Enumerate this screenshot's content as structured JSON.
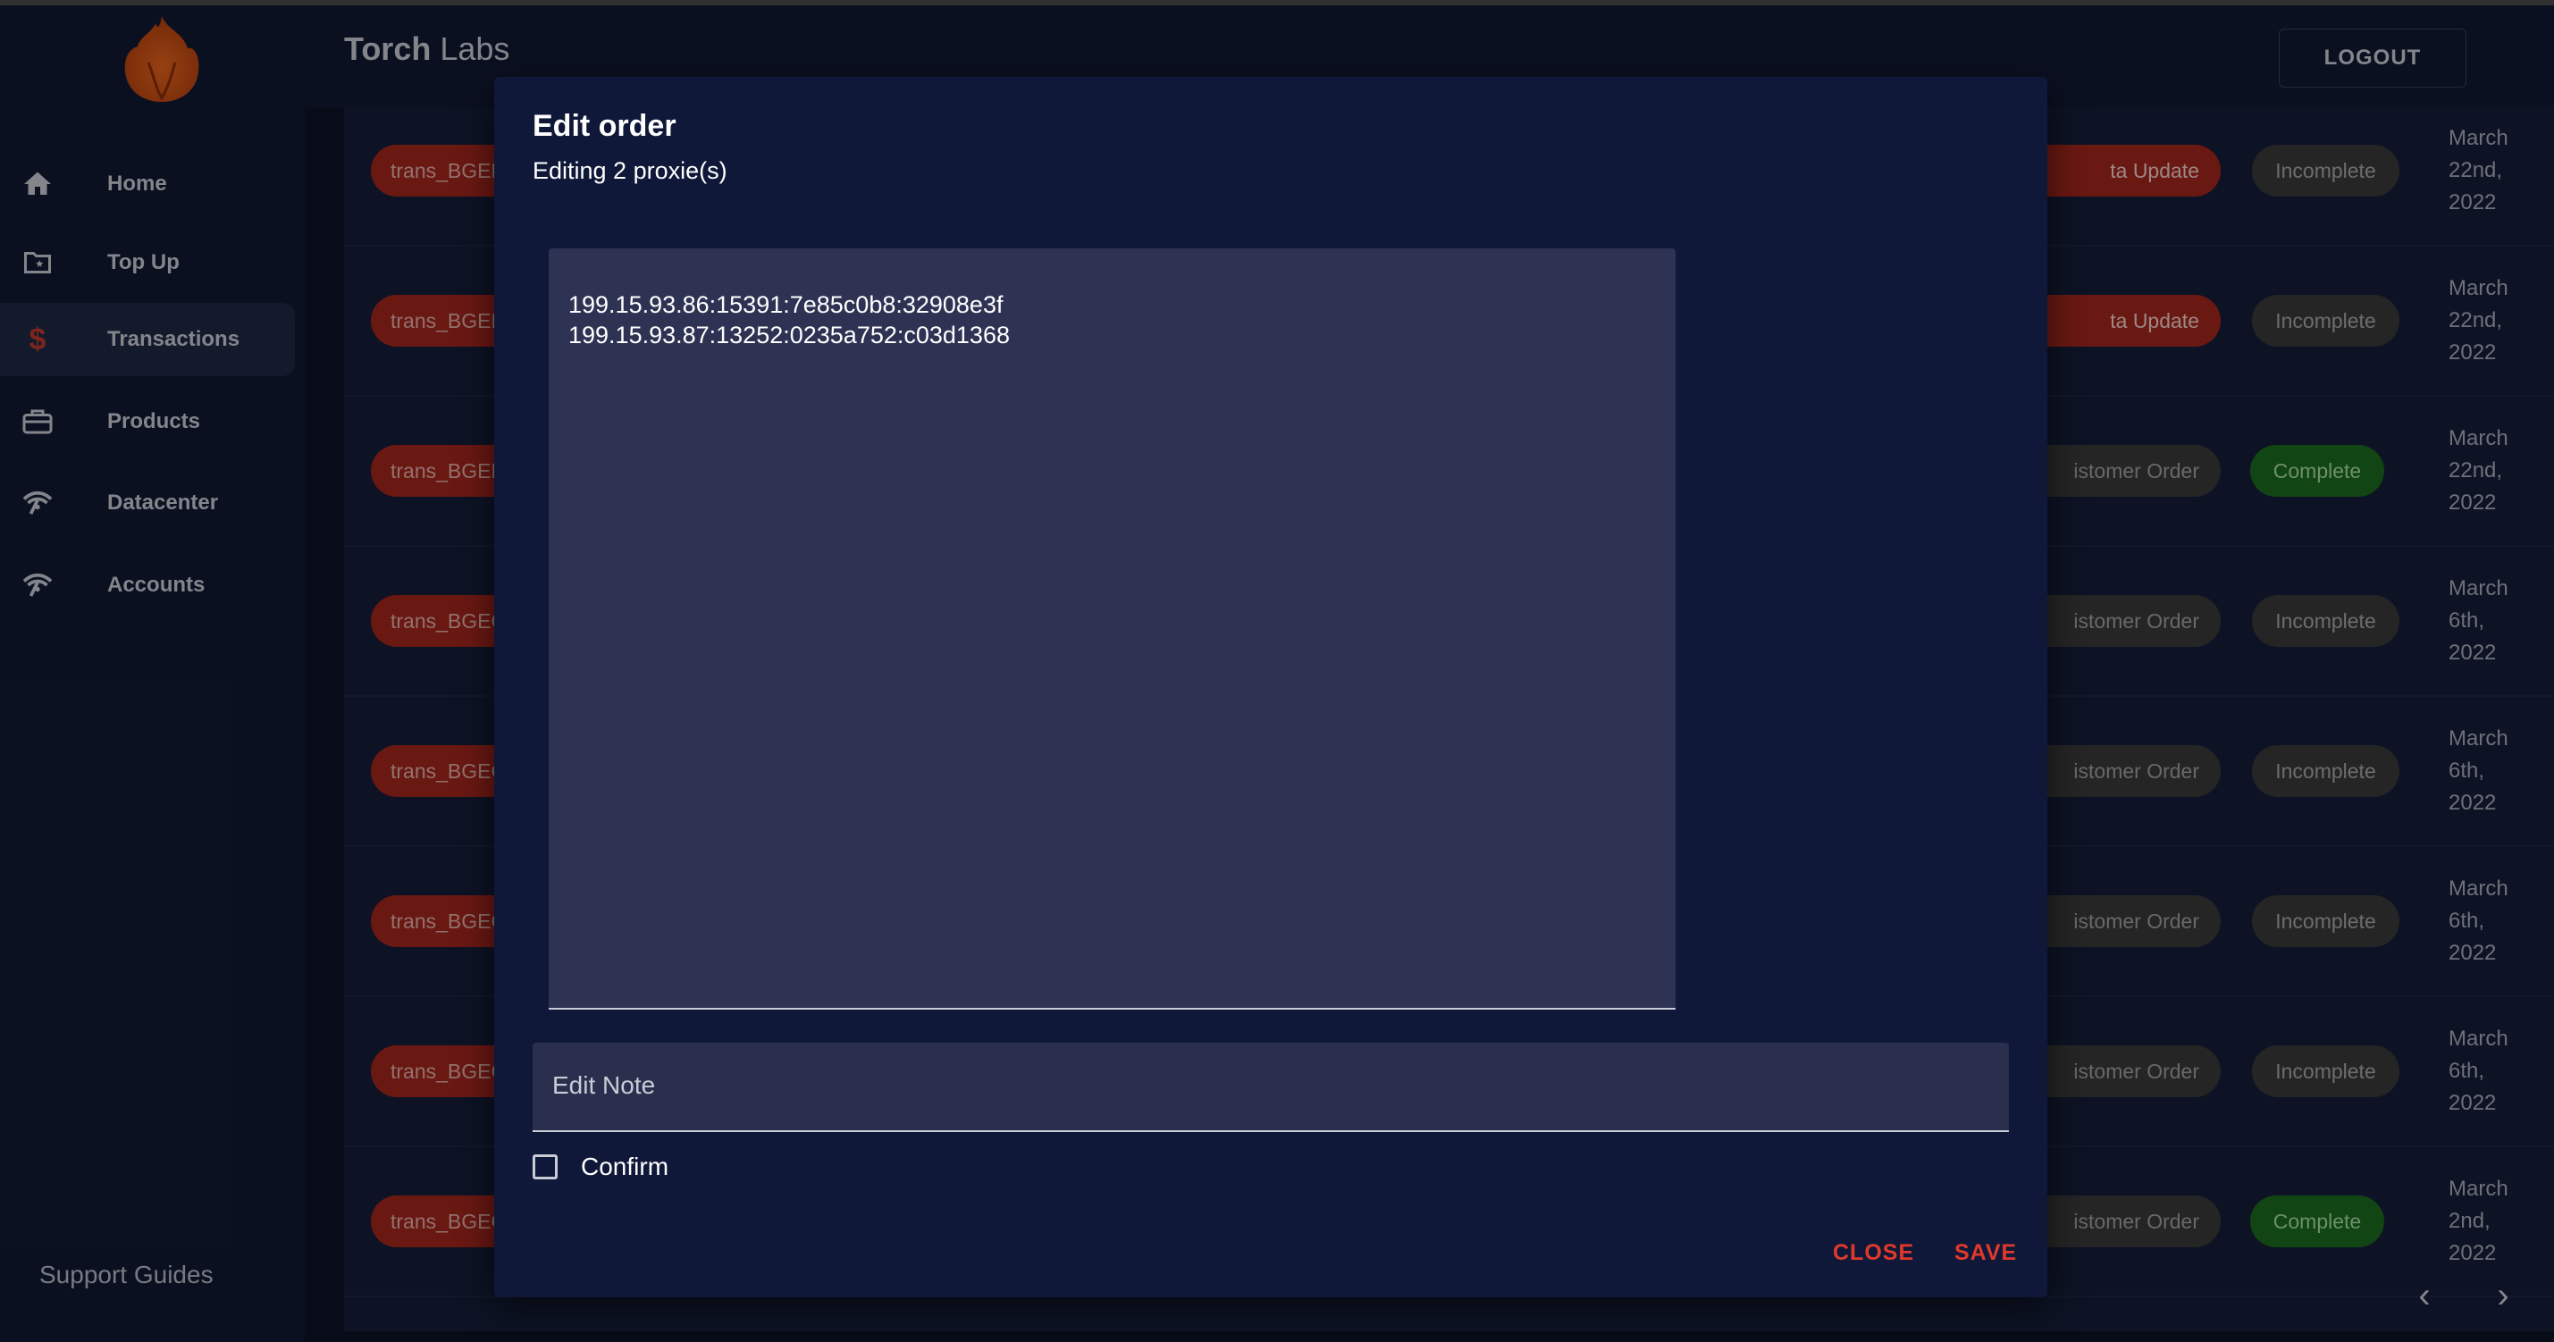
{
  "header": {
    "brand_bold": "Torch",
    "brand_light": "Labs",
    "logout_label": "LOGOUT"
  },
  "sidebar": {
    "items": [
      {
        "label": "Home",
        "icon": "home-icon"
      },
      {
        "label": "Top Up",
        "icon": "folder-star-icon"
      },
      {
        "label": "Transactions",
        "icon": "dollar-icon",
        "active": true
      },
      {
        "label": "Products",
        "icon": "briefcase-icon"
      },
      {
        "label": "Datacenter",
        "icon": "wifi-icon"
      },
      {
        "label": "Accounts",
        "icon": "wifi-icon"
      }
    ],
    "support_label": "Support Guides"
  },
  "table": {
    "rows": [
      {
        "id": "trans_BGEH",
        "type": "ta Update",
        "status": "Incomplete",
        "date_l1": "March",
        "date_l2": "22nd,",
        "date_l3": "2022"
      },
      {
        "id": "trans_BGEH",
        "type": "ta Update",
        "status": "Incomplete",
        "date_l1": "March",
        "date_l2": "22nd,",
        "date_l3": "2022"
      },
      {
        "id": "trans_BGEH",
        "type": "istomer Order",
        "status": "Complete",
        "date_l1": "March",
        "date_l2": "22nd,",
        "date_l3": "2022"
      },
      {
        "id": "trans_BGEC",
        "type": "istomer Order",
        "status": "Incomplete",
        "date_l1": "March",
        "date_l2": "6th,",
        "date_l3": "2022"
      },
      {
        "id": "trans_BGEC",
        "type": "istomer Order",
        "status": "Incomplete",
        "date_l1": "March",
        "date_l2": "6th,",
        "date_l3": "2022"
      },
      {
        "id": "trans_BGEC",
        "type": "istomer Order",
        "status": "Incomplete",
        "date_l1": "March",
        "date_l2": "6th,",
        "date_l3": "2022"
      },
      {
        "id": "trans_BGEC",
        "type": "istomer Order",
        "status": "Incomplete",
        "date_l1": "March",
        "date_l2": "6th,",
        "date_l3": "2022"
      },
      {
        "id": "trans_BGEC",
        "type": "istomer Order",
        "status": "Complete",
        "date_l1": "March",
        "date_l2": "2nd,",
        "date_l3": "2022"
      }
    ]
  },
  "modal": {
    "title": "Edit order",
    "subtitle": "Editing 2 proxie(s)",
    "proxies_text": "199.15.93.86:15391:7e85c0b8:32908e3f\n199.15.93.87:13252:0235a752:c03d1368",
    "note_placeholder": "Edit Note",
    "confirm_label": "Confirm",
    "close_label": "CLOSE",
    "save_label": "SAVE"
  },
  "colors": {
    "accent": "#e0392b",
    "complete": "#1b6a1e",
    "trans_pill": "#a3261d"
  }
}
